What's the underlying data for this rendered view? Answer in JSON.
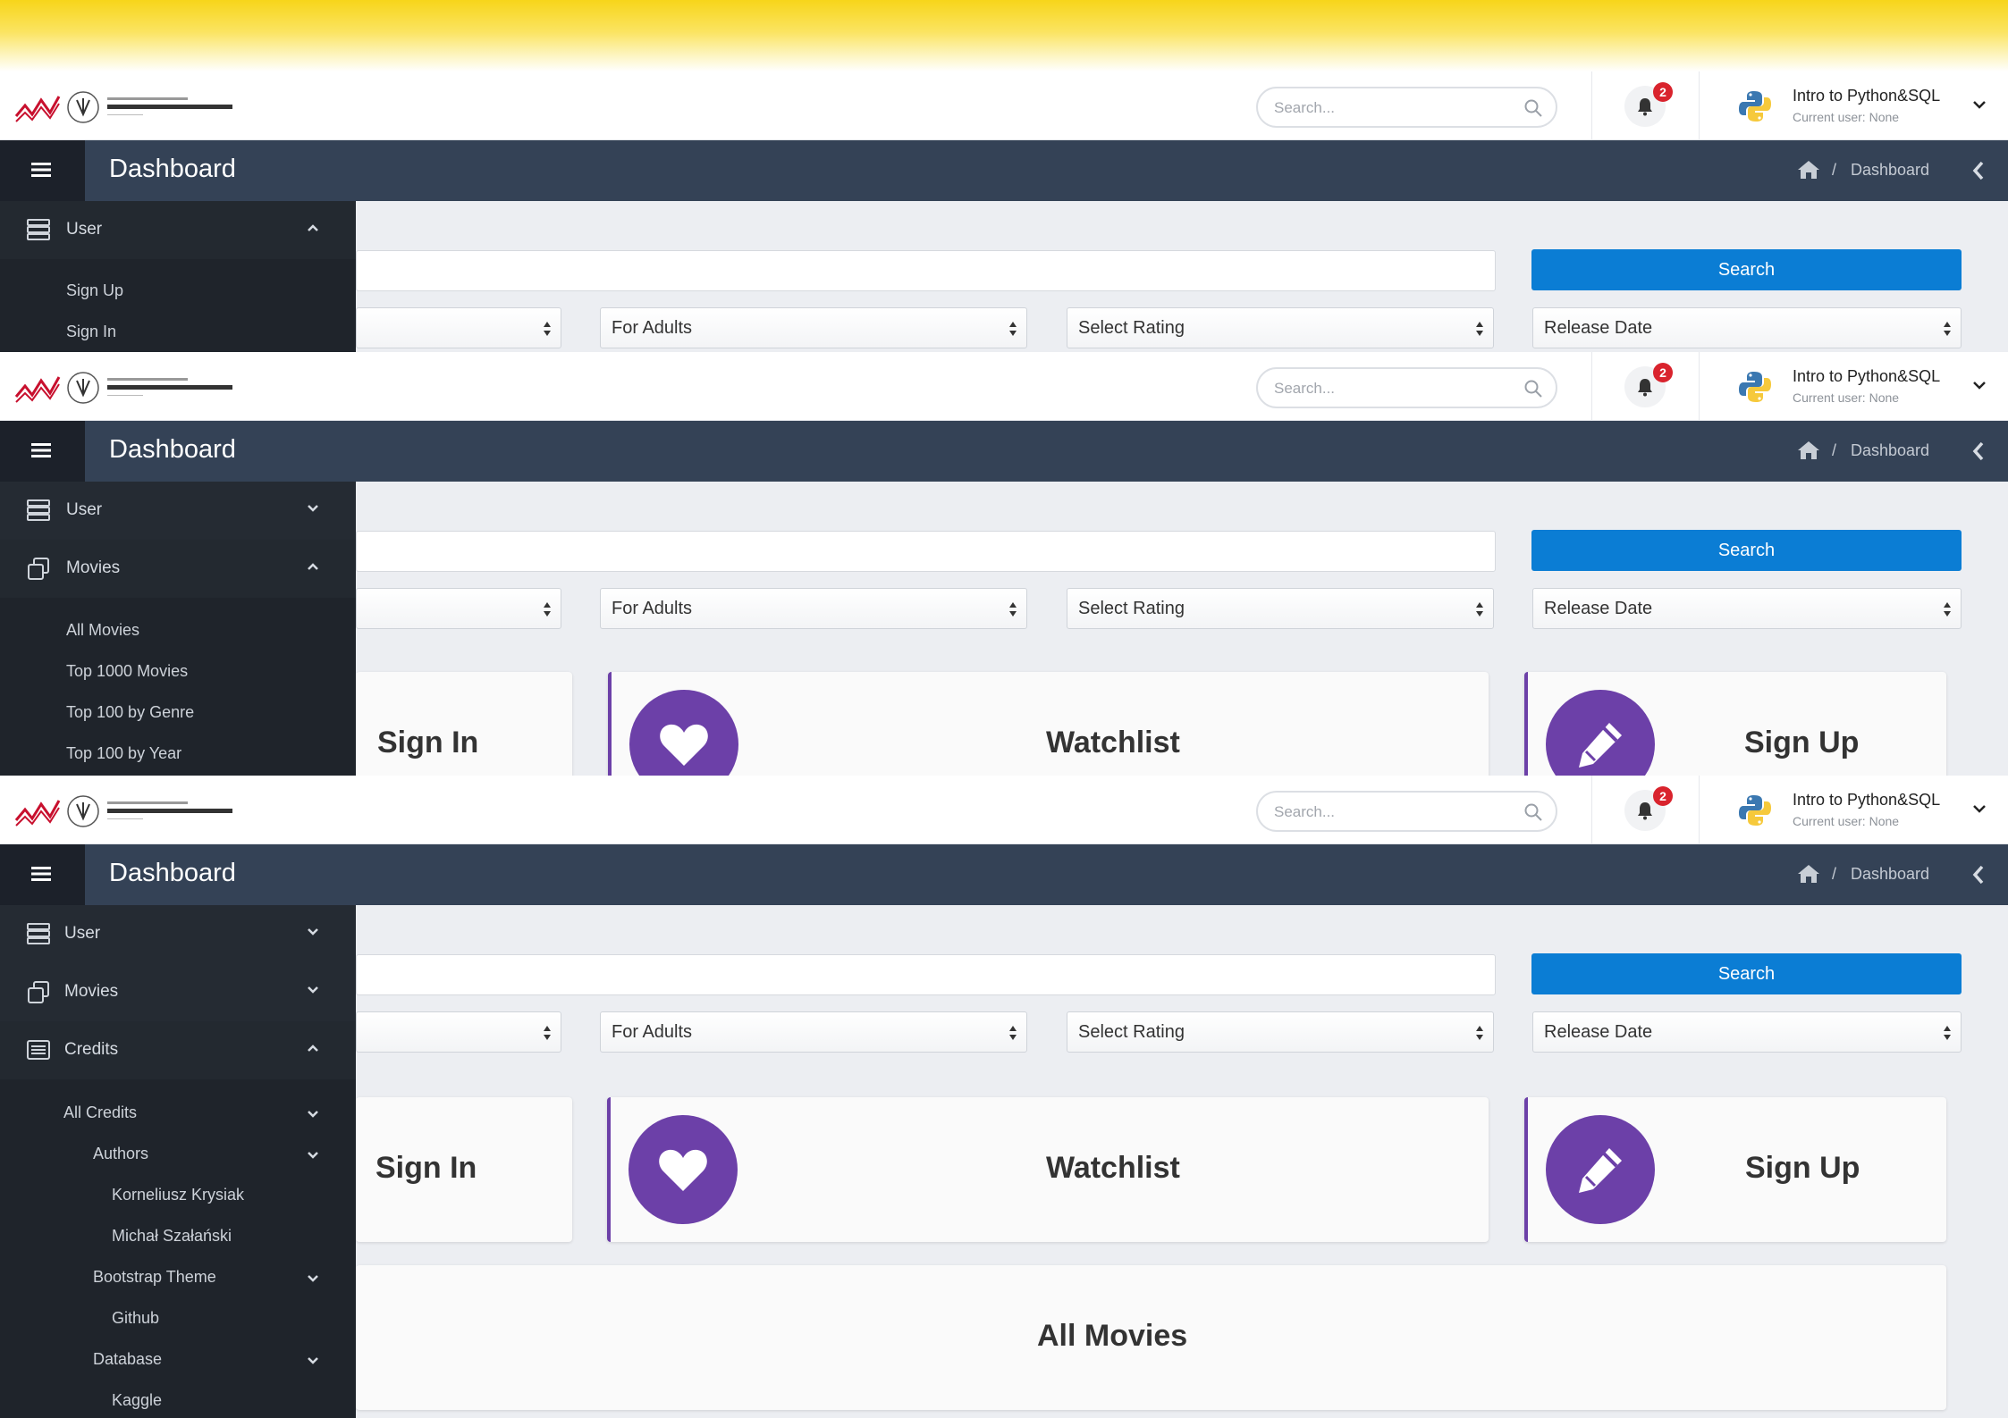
{
  "topbar": {
    "search_placeholder": "Search...",
    "notifications_count": "2",
    "user_name": "Intro to Python&SQL",
    "user_sub": "Current user: None"
  },
  "header": {
    "title": "Dashboard",
    "breadcrumb_sep": "/",
    "breadcrumb_current": "Dashboard"
  },
  "filters": {
    "search_button": "Search",
    "for_adults": "For Adults",
    "select_rating": "Select Rating",
    "release_date": "Release Date"
  },
  "cards": {
    "sign_in": "Sign In",
    "watchlist": "Watchlist",
    "sign_up": "Sign Up",
    "all_movies": "All Movies"
  },
  "sidebar": {
    "user": "User",
    "sign_up": "Sign Up",
    "sign_in": "Sign In",
    "movies": "Movies",
    "all_movies": "All Movies",
    "top_1000": "Top 1000 Movies",
    "top_100_genre": "Top 100 by Genre",
    "top_100_year": "Top 100 by Year",
    "credits": "Credits",
    "all_credits": "All Credits",
    "authors": "Authors",
    "author_1": "Korneliusz Krysiak",
    "author_2": "Michał Szałański",
    "bootstrap_theme": "Bootstrap Theme",
    "github": "Github",
    "database": "Database",
    "kaggle": "Kaggle"
  },
  "colors": {
    "header": "#344256",
    "sidebar": "#1f242b",
    "accent_purple": "#6c40a8",
    "search_blue": "#0b7dd4",
    "badge_red": "#d9232d"
  }
}
